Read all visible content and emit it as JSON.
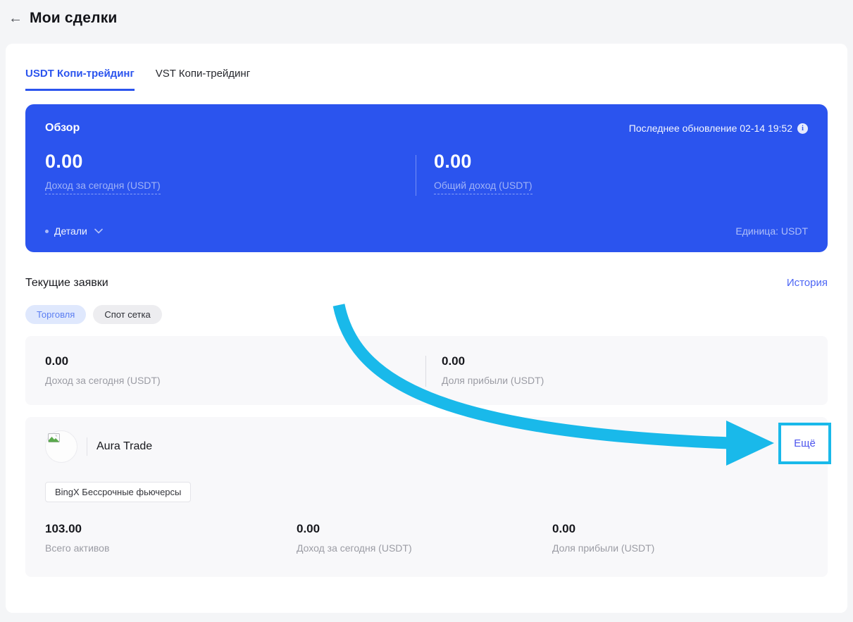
{
  "colors": {
    "accent_blue": "#2b54ee",
    "annotation_cyan": "#19b9ea",
    "link_blue": "#4d66f5",
    "card_gray": "#f8f8fa"
  },
  "header": {
    "back_icon": "←",
    "title": "Мои сделки"
  },
  "tabs": [
    {
      "label": "USDT Копи-трейдинг",
      "active": true
    },
    {
      "label": "VST Копи-трейдинг",
      "active": false
    }
  ],
  "overview": {
    "title": "Обзор",
    "last_update": "Последнее обновление 02-14 19:52",
    "stats": [
      {
        "value": "0.00",
        "label": "Доход за сегодня (USDT)"
      },
      {
        "value": "0.00",
        "label": "Общий доход (USDT)"
      }
    ],
    "details_label": "Детали",
    "unit_label": "Единица: USDT"
  },
  "orders": {
    "title": "Текущие заявки",
    "history_link": "История",
    "filters": [
      {
        "label": "Торговля",
        "active": true
      },
      {
        "label": "Спот сетка",
        "active": false
      }
    ],
    "summary": [
      {
        "value": "0.00",
        "label": "Доход за сегодня (USDT)"
      },
      {
        "value": "0.00",
        "label": "Доля прибыли (USDT)"
      }
    ],
    "trader": {
      "name": "Aura Trade",
      "badge": "BingX Бессрочные фьючерсы",
      "stats": [
        {
          "value": "103.00",
          "label": "Всего активов"
        },
        {
          "value": "0.00",
          "label": "Доход за сегодня (USDT)"
        },
        {
          "value": "0.00",
          "label": "Доля прибыли (USDT)"
        }
      ],
      "more_label": "Ещё"
    }
  }
}
